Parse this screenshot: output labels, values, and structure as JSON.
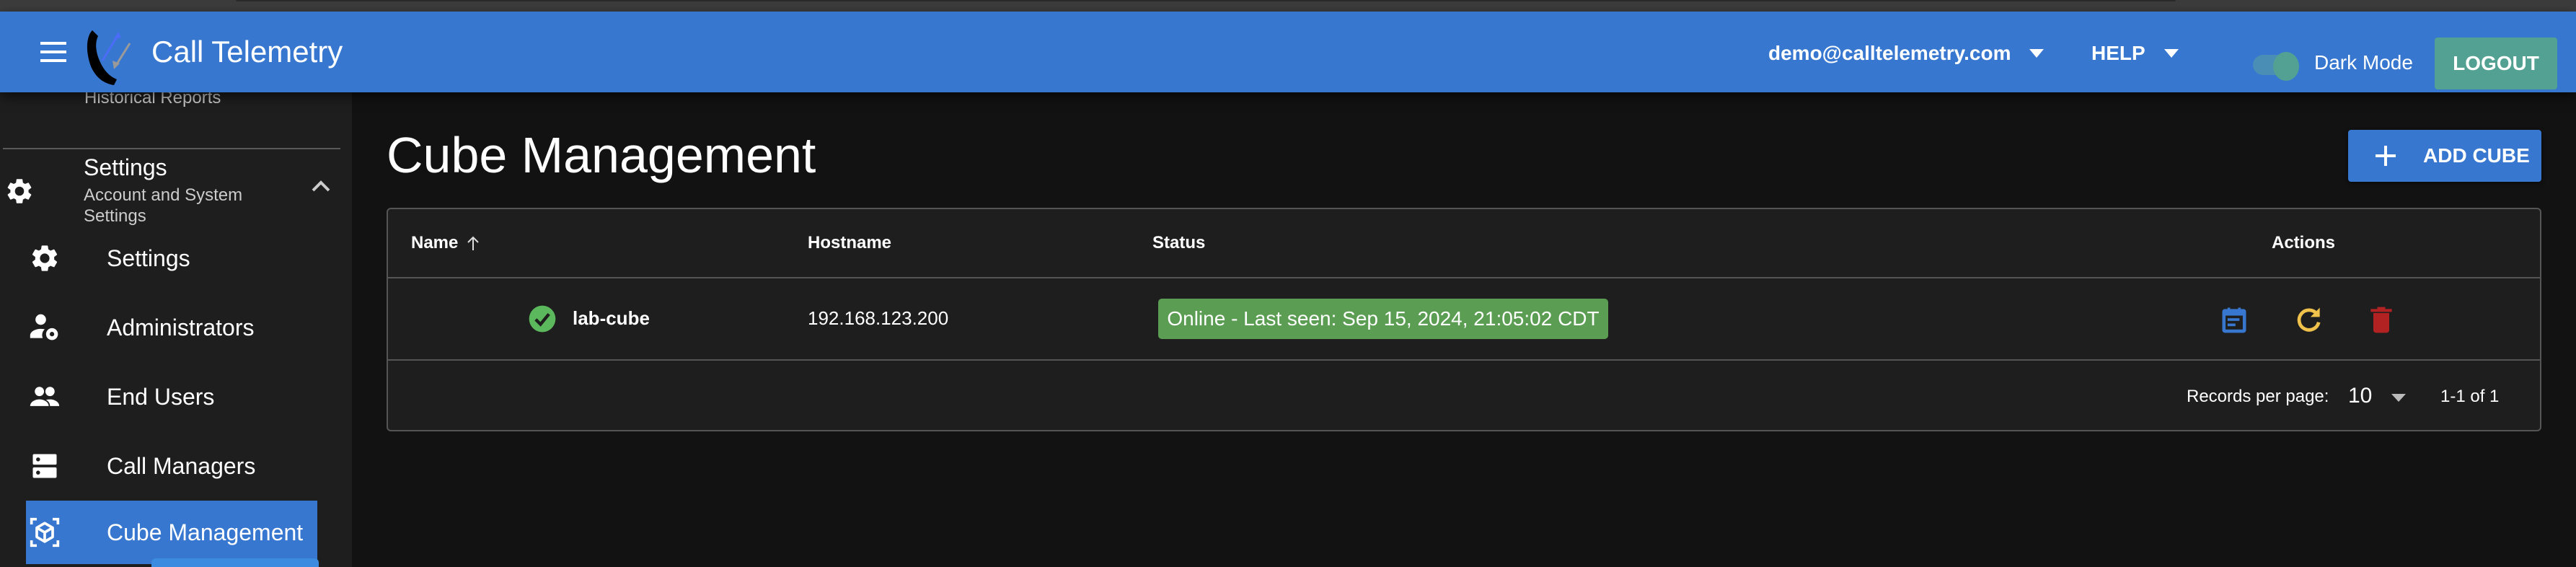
{
  "header": {
    "app_title": "Call Telemetry",
    "user_email": "demo@calltelemetry.com",
    "help_label": "HELP",
    "dark_mode_label": "Dark Mode",
    "dark_mode_on": true,
    "logout_label": "LOGOUT",
    "brand_color": "#3777d0"
  },
  "sidebar": {
    "partial_item": "Historical Reports",
    "group": {
      "title": "Settings",
      "subtitle": "Account and System Settings",
      "expanded": true
    },
    "items": [
      {
        "label": "Settings",
        "icon": "gear-icon",
        "active": false
      },
      {
        "label": "Administrators",
        "icon": "admin-user-gear-icon",
        "active": false
      },
      {
        "label": "End Users",
        "icon": "people-icon",
        "active": false
      },
      {
        "label": "Call Managers",
        "icon": "server-icon",
        "active": false
      },
      {
        "label": "Cube Management",
        "icon": "cube-scan-icon",
        "active": true
      }
    ]
  },
  "main": {
    "page_title": "Cube Management",
    "add_button_label": "ADD CUBE",
    "table": {
      "columns": [
        {
          "label": "Name",
          "sort": "ascending"
        },
        {
          "label": "Hostname"
        },
        {
          "label": "Status"
        },
        {
          "label": "Actions"
        }
      ],
      "rows": [
        {
          "status_icon": "check-circle-icon",
          "name": "lab-cube",
          "hostname": "192.168.123.200",
          "status": "Online - Last seen: Sep 15, 2024, 21:05:02 CDT",
          "status_color": "#5b9e53",
          "actions": [
            {
              "name": "calendar-logs-icon",
              "color": "#3777d0"
            },
            {
              "name": "refresh-icon",
              "color": "#f0c24b"
            },
            {
              "name": "delete-icon",
              "color": "#b22222"
            }
          ]
        }
      ],
      "footer": {
        "records_per_page_label": "Records per page:",
        "records_per_page_value": "10",
        "range_text": "1-1 of 1"
      }
    }
  }
}
